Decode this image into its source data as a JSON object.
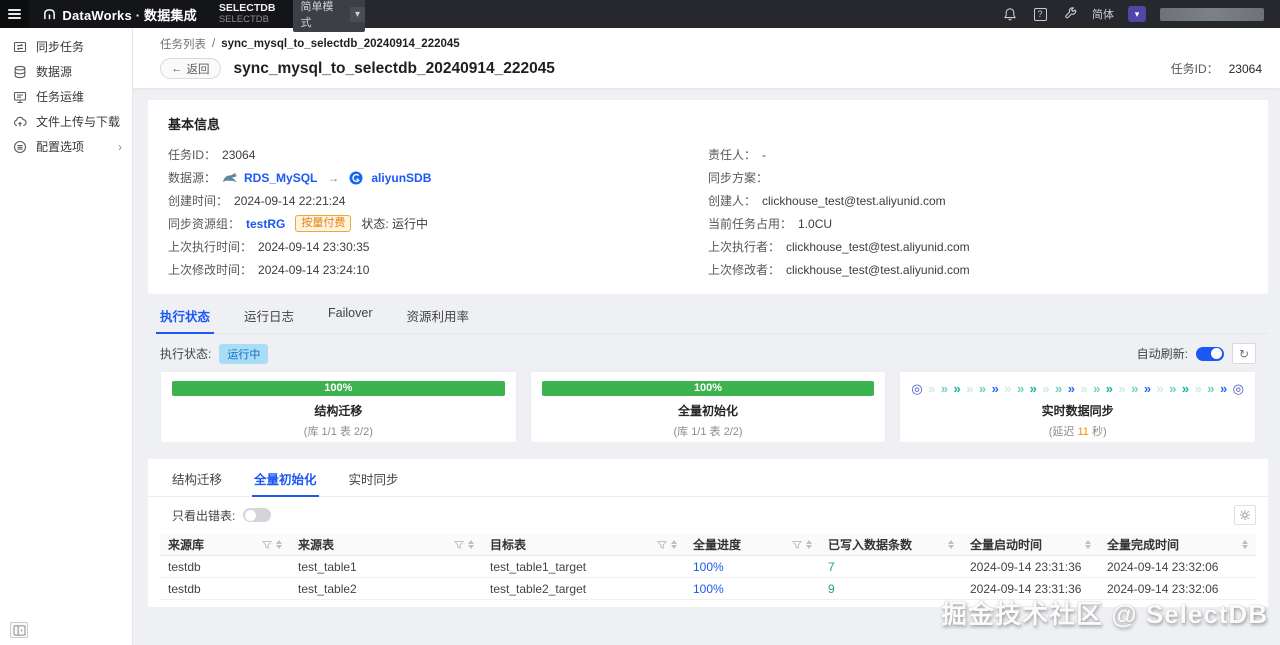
{
  "topbar": {
    "product": "DataWorks · 数据集成",
    "workspace": {
      "name": "SELECTDB",
      "sub": "SELECTDB"
    },
    "mode": "简单模式",
    "lang": "简体"
  },
  "sidebar": {
    "items": [
      {
        "label": "同步任务"
      },
      {
        "label": "数据源"
      },
      {
        "label": "任务运维"
      },
      {
        "label": "文件上传与下载"
      },
      {
        "label": "配置选项"
      }
    ]
  },
  "breadcrumb": {
    "root": "任务列表",
    "sep": "/",
    "current": "sync_mysql_to_selectdb_20240914_222045"
  },
  "header": {
    "back": "返回",
    "title": "sync_mysql_to_selectdb_20240914_222045",
    "task_id_label": "任务ID：",
    "task_id": "23064"
  },
  "basic": {
    "title": "基本信息",
    "task_id_label": "任务ID：",
    "task_id": "23064",
    "datasource_label": "数据源：",
    "source": "RDS_MySQL",
    "target": "aliyunSDB",
    "created_label": "创建时间：",
    "created": "2024-09-14 22:21:24",
    "rg_label": "同步资源组：",
    "rg": "testRG",
    "rg_badge": "按量付费",
    "rg_status": "状态: 运行中",
    "last_run_label": "上次执行时间：",
    "last_run": "2024-09-14 23:30:35",
    "last_modified_label": "上次修改时间：",
    "last_modified": "2024-09-14 23:24:10",
    "owner_label": "责任人：",
    "owner": "-",
    "plan_label": "同步方案：",
    "plan": "",
    "creator_label": "创建人：",
    "creator": "clickhouse_test@test.aliyunid.com",
    "usage_label": "当前任务占用：",
    "usage": "1.0CU",
    "last_executor_label": "上次执行者：",
    "last_executor": "clickhouse_test@test.aliyunid.com",
    "last_modifier_label": "上次修改者：",
    "last_modifier": "clickhouse_test@test.aliyunid.com"
  },
  "tabs": [
    {
      "label": "执行状态"
    },
    {
      "label": "运行日志"
    },
    {
      "label": "Failover"
    },
    {
      "label": "资源利用率"
    }
  ],
  "status_bar": {
    "label": "执行状态:",
    "badge": "运行中",
    "auto_refresh_label": "自动刷新:",
    "auto_refresh_on": true
  },
  "progress_cards": [
    {
      "percent": "100%",
      "title": "结构迁移",
      "subtitle": "(库 1/1 表 2/2)"
    },
    {
      "percent": "100%",
      "title": "全量初始化",
      "subtitle": "(库 1/1 表 2/2)"
    },
    {
      "title": "实时数据同步",
      "delay_prefix": "(延迟 ",
      "delay_value": "11",
      "delay_suffix": " 秒)"
    }
  ],
  "detail": {
    "tabs": [
      {
        "label": "结构迁移"
      },
      {
        "label": "全量初始化"
      },
      {
        "label": "实时同步"
      }
    ],
    "error_filter_label": "只看出错表:",
    "table": {
      "columns": [
        {
          "label": "来源库"
        },
        {
          "label": "来源表"
        },
        {
          "label": "目标表"
        },
        {
          "label": "全量进度"
        },
        {
          "label": "已写入数据条数"
        },
        {
          "label": "全量启动时间"
        },
        {
          "label": "全量完成时间"
        }
      ],
      "rows": [
        {
          "source_db": "testdb",
          "source_table": "test_table1",
          "target_table": "test_table1_target",
          "progress": "100%",
          "written": "7",
          "start_time": "2024-09-14 23:31:36",
          "end_time": "2024-09-14 23:32:06"
        },
        {
          "source_db": "testdb",
          "source_table": "test_table2",
          "target_table": "test_table2_target",
          "progress": "100%",
          "written": "9",
          "start_time": "2024-09-14 23:31:36",
          "end_time": "2024-09-14 23:32:06"
        }
      ]
    }
  },
  "watermark": "掘金技术社区 @ SelectDB",
  "icons": {
    "back_arrow": "←",
    "flow_arrow": "→",
    "chevron_down": "▾",
    "chevron_right": "›",
    "refresh": "↻",
    "help": "?",
    "sync_endpoint": "◎",
    "sync_chevron": "»"
  },
  "colors": {
    "accent_blue": "#1b58f4",
    "success_green": "#3cb34f",
    "running_badge_bg": "#a9ddf6",
    "running_badge_text": "#0d6cc2",
    "postpaid_badge_orange": "#e58313",
    "delay_orange": "#ff8a00",
    "written_green": "#21a675",
    "sync_teal": "#18b3a3"
  }
}
